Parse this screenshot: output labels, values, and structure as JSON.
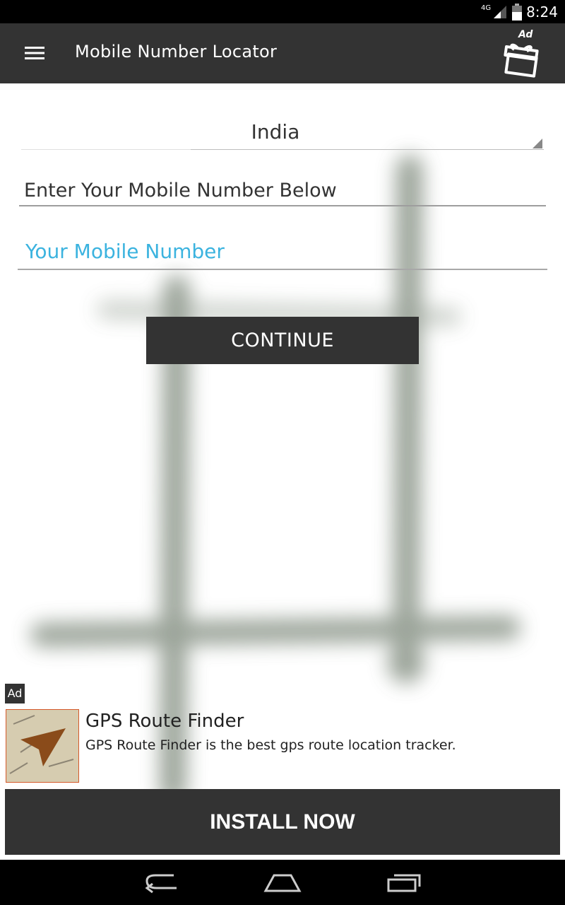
{
  "status_bar": {
    "network_label": "4G",
    "time": "8:24",
    "icons": [
      "signal-icon",
      "battery-icon"
    ]
  },
  "app_bar": {
    "title": "Mobile Number Locator",
    "ad_label": "Ad",
    "icons": [
      "menu-icon",
      "gift-icon"
    ]
  },
  "form": {
    "country": "India",
    "prompt": "Enter Your Mobile Number Below",
    "mobile_placeholder": "Your Mobile Number",
    "mobile_value": "",
    "continue_label": "CONTINUE"
  },
  "ad": {
    "badge": "Ad",
    "title": "GPS Route Finder",
    "description": "GPS Route Finder is the best gps route location tracker.",
    "install_label": "INSTALL NOW"
  },
  "nav_bar": {
    "icons": [
      "back-icon",
      "home-icon",
      "recents-icon"
    ]
  },
  "colors": {
    "app_bar": "#333333",
    "placeholder": "#3bb3df",
    "button": "#333333",
    "ad_thumb_border": "#d55a2a"
  }
}
